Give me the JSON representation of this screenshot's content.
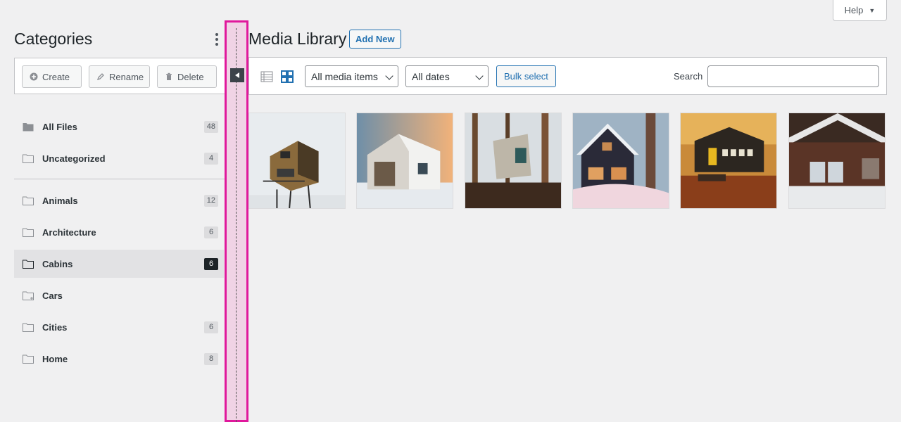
{
  "help": {
    "label": "Help"
  },
  "sidebar": {
    "title": "Categories",
    "toolbar": {
      "create": "Create",
      "rename": "Rename",
      "delete": "Delete"
    },
    "items": [
      {
        "label": "All Files",
        "count": "48"
      },
      {
        "label": "Uncategorized",
        "count": "4"
      },
      {
        "label": "Animals",
        "count": "12"
      },
      {
        "label": "Architecture",
        "count": "6"
      },
      {
        "label": "Cabins",
        "count": "6",
        "active": true
      },
      {
        "label": "Cars",
        "count": ""
      },
      {
        "label": "Cities",
        "count": "6"
      },
      {
        "label": "Home",
        "count": "8"
      }
    ]
  },
  "main": {
    "title": "Media Library",
    "add_new": "Add New",
    "filters": {
      "media_type": "All media items",
      "dates": "All dates",
      "bulk_select": "Bulk select",
      "search_label": "Search",
      "search_value": ""
    },
    "images": [
      {
        "name": "cabin-stilts"
      },
      {
        "name": "cabin-white-snow"
      },
      {
        "name": "cabin-treehouse"
      },
      {
        "name": "cabin-dark-snow"
      },
      {
        "name": "cabin-autumn"
      },
      {
        "name": "cabin-barn-snow"
      }
    ]
  },
  "colors": {
    "accent": "#2271b1",
    "highlight": "#e0189c",
    "active_bg": "#e2e2e4"
  }
}
